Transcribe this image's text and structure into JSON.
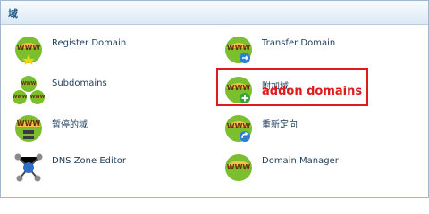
{
  "header": {
    "title": "域"
  },
  "items": [
    {
      "label": "Register Domain",
      "icon": "globe-star-icon"
    },
    {
      "label": "Transfer Domain",
      "icon": "globe-transfer-icon"
    },
    {
      "label": "Subdomains",
      "icon": "globe-cluster-icon"
    },
    {
      "label": "附加域",
      "icon": "globe-plus-icon"
    },
    {
      "label": "暂停的域",
      "icon": "globe-pause-icon"
    },
    {
      "label": "重新定向",
      "icon": "globe-redirect-icon"
    },
    {
      "label": "DNS Zone Editor",
      "icon": "network-icon"
    },
    {
      "label": "Domain Manager",
      "icon": "globe-icon"
    }
  ],
  "annotation": {
    "text": "addon domains",
    "color": "#e11b1b"
  },
  "colors": {
    "header_text": "#1f5a8a",
    "label_text": "#1e3d59",
    "globe_text": "#6a2f00"
  }
}
